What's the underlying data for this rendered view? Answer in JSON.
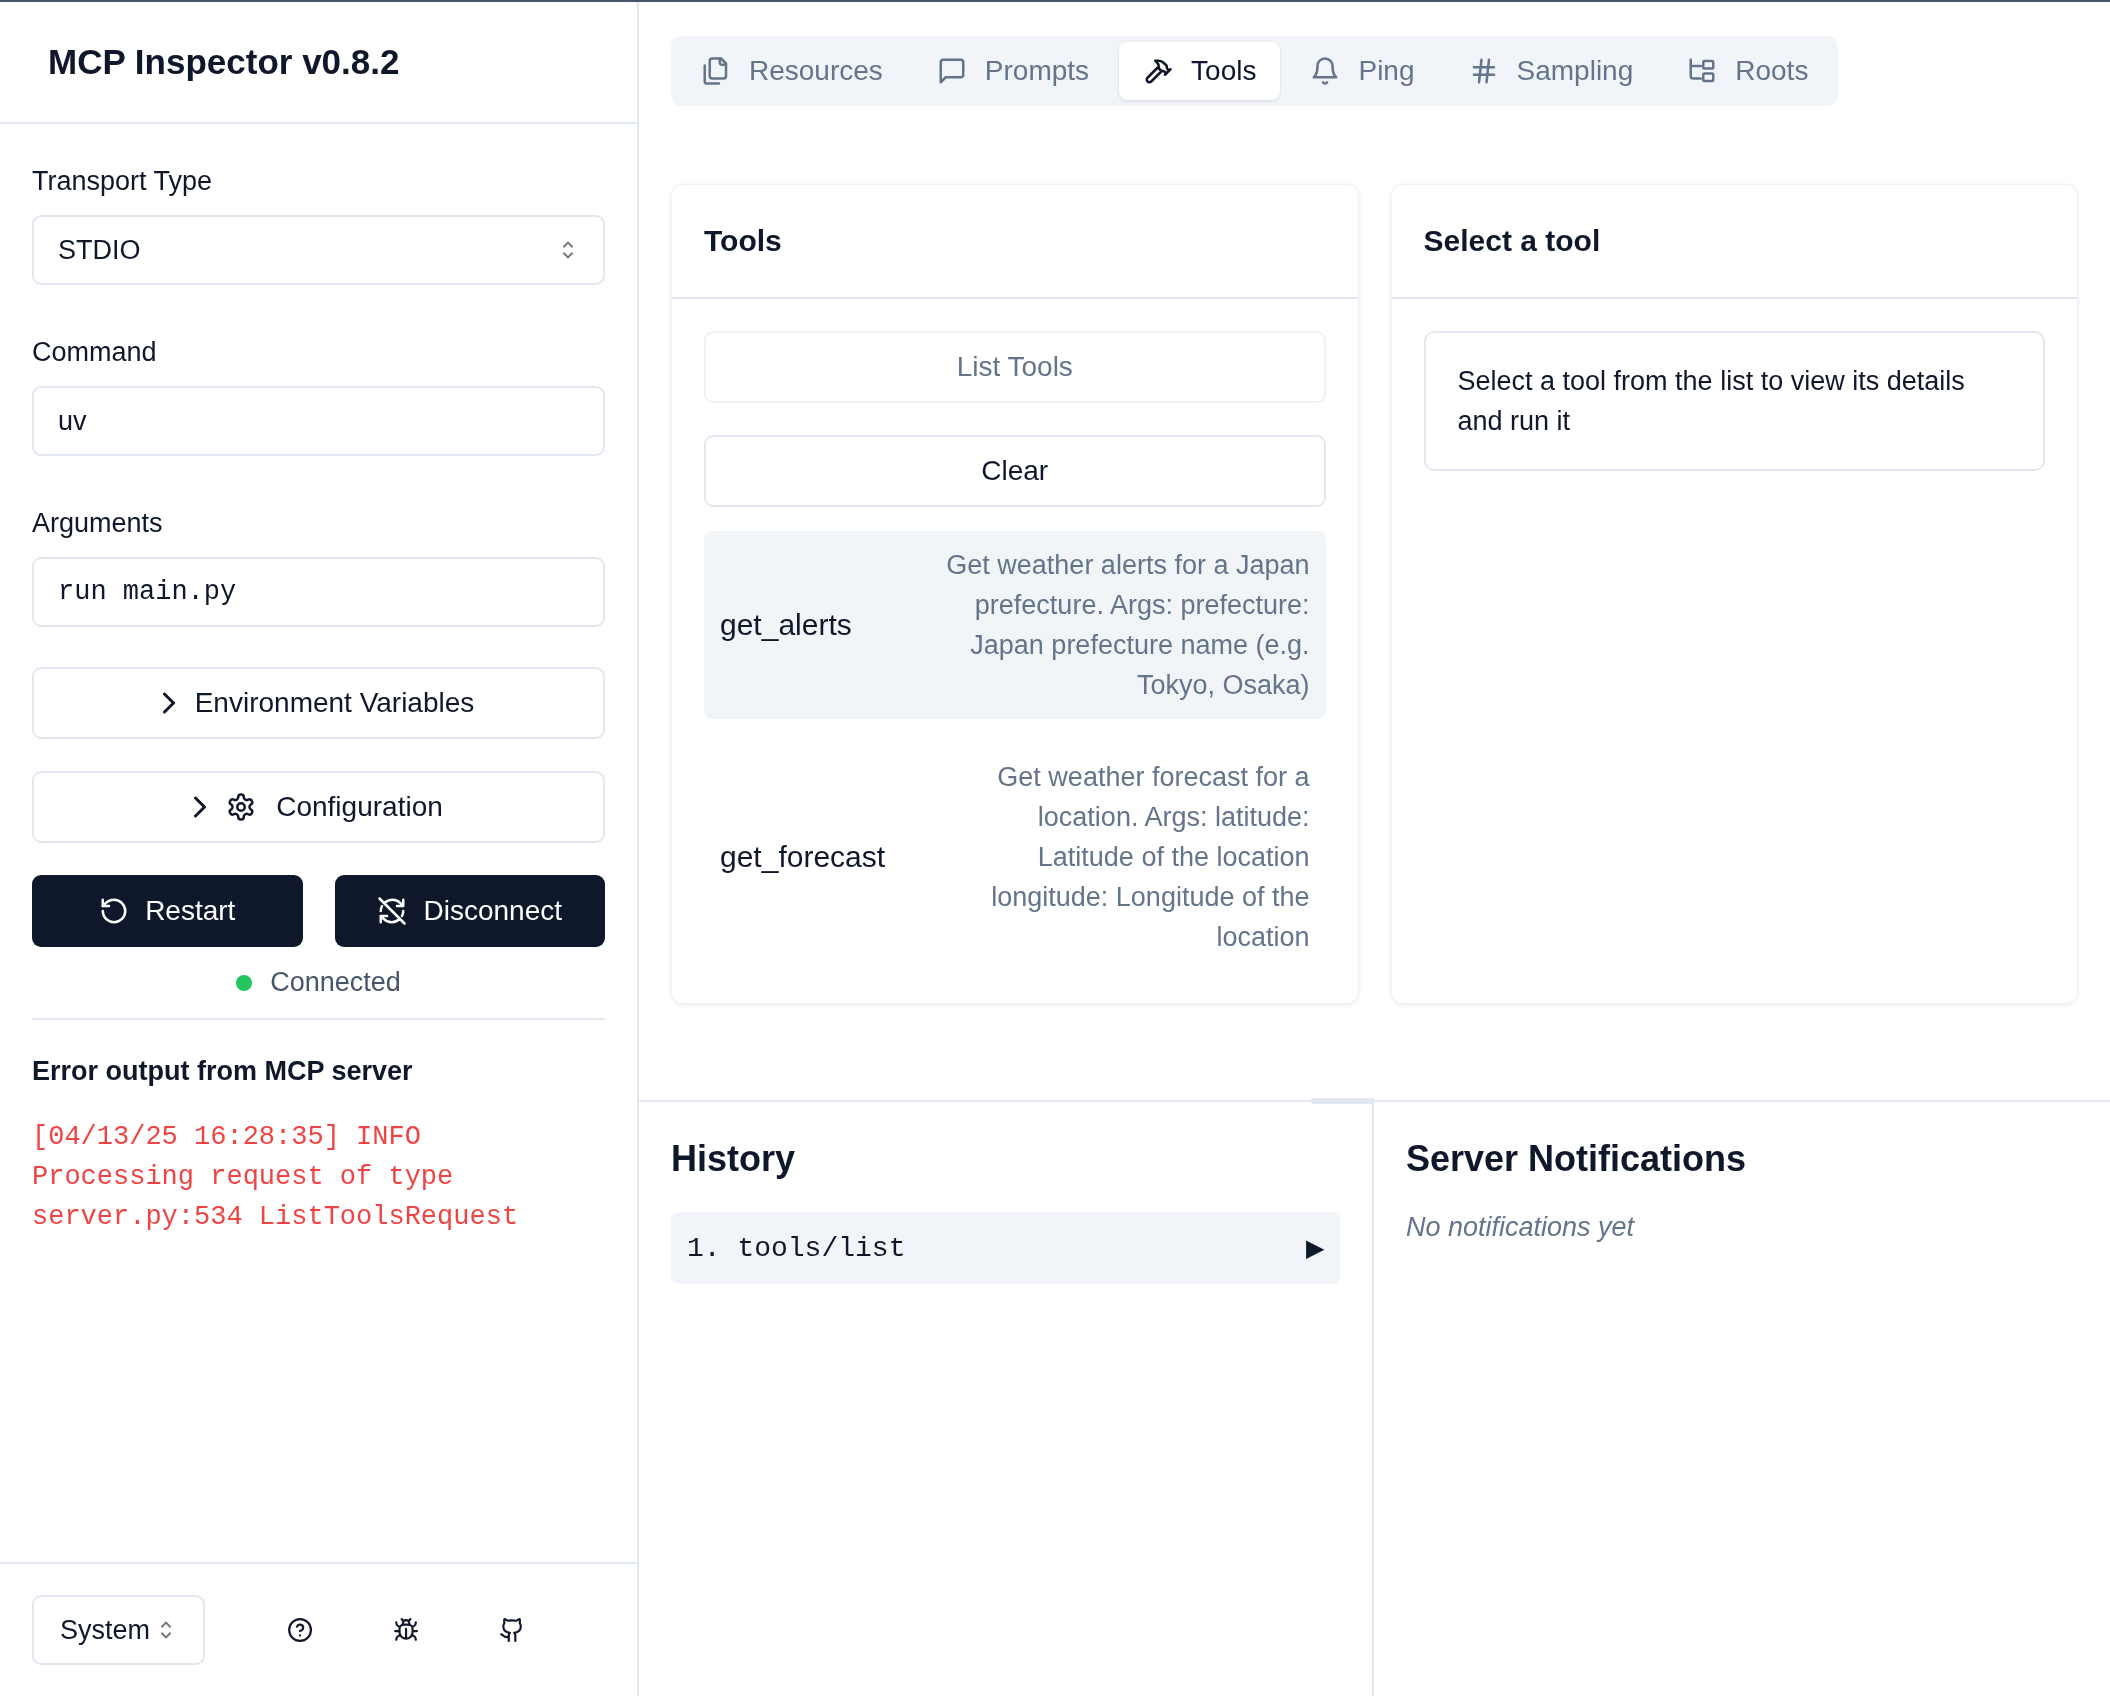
{
  "sidebar": {
    "title": "MCP Inspector v0.8.2",
    "transport": {
      "label": "Transport Type",
      "value": "STDIO"
    },
    "command": {
      "label": "Command",
      "value": "uv"
    },
    "arguments": {
      "label": "Arguments",
      "value": "run main.py"
    },
    "toggles": [
      {
        "label": "Environment Variables",
        "kind": "plain",
        "expanded": false
      },
      {
        "label": "Configuration",
        "kind": "gear",
        "expanded": false
      }
    ],
    "actions": [
      {
        "label": "Restart",
        "kind": "restart"
      },
      {
        "label": "Disconnect",
        "kind": "disconnect"
      }
    ],
    "status": {
      "label": "Connected",
      "color": "#22c55e"
    },
    "error_output": {
      "title": "Error output from MCP server",
      "lines": [
        "[04/13/25 16:28:35] INFO",
        "Processing request of type",
        "server.py:534 ListToolsRequest"
      ]
    },
    "theme": {
      "value": "System"
    }
  },
  "tabs": [
    {
      "label": "Resources",
      "kind": "resources",
      "selected": false
    },
    {
      "label": "Prompts",
      "kind": "prompts",
      "selected": false
    },
    {
      "label": "Tools",
      "kind": "tools",
      "selected": true
    },
    {
      "label": "Ping",
      "kind": "ping",
      "selected": false
    },
    {
      "label": "Sampling",
      "kind": "sampling",
      "selected": false
    },
    {
      "label": "Roots",
      "kind": "roots",
      "selected": false
    }
  ],
  "tools_panel": {
    "title": "Tools",
    "list_button": {
      "label": "List Tools",
      "disabled": true
    },
    "clear_button": {
      "label": "Clear"
    },
    "tools": [
      {
        "name": "get_alerts",
        "description": "Get weather alerts for a Japan prefecture. Args: prefecture: Japan prefecture name (e.g. Tokyo, Osaka)",
        "hovered": true
      },
      {
        "name": "get_forecast",
        "description": "Get weather forecast for a location. Args: latitude: Latitude of the location longitude: Longitude of the location",
        "hovered": false
      }
    ]
  },
  "detail_panel": {
    "title": "Select a tool",
    "message": "Select a tool from the list to view its details and run it"
  },
  "history": {
    "title": "History",
    "items": [
      {
        "label": "1. tools/list",
        "toggle": "▶"
      }
    ]
  },
  "notifications": {
    "title": "Server Notifications",
    "empty": "No notifications yet"
  }
}
